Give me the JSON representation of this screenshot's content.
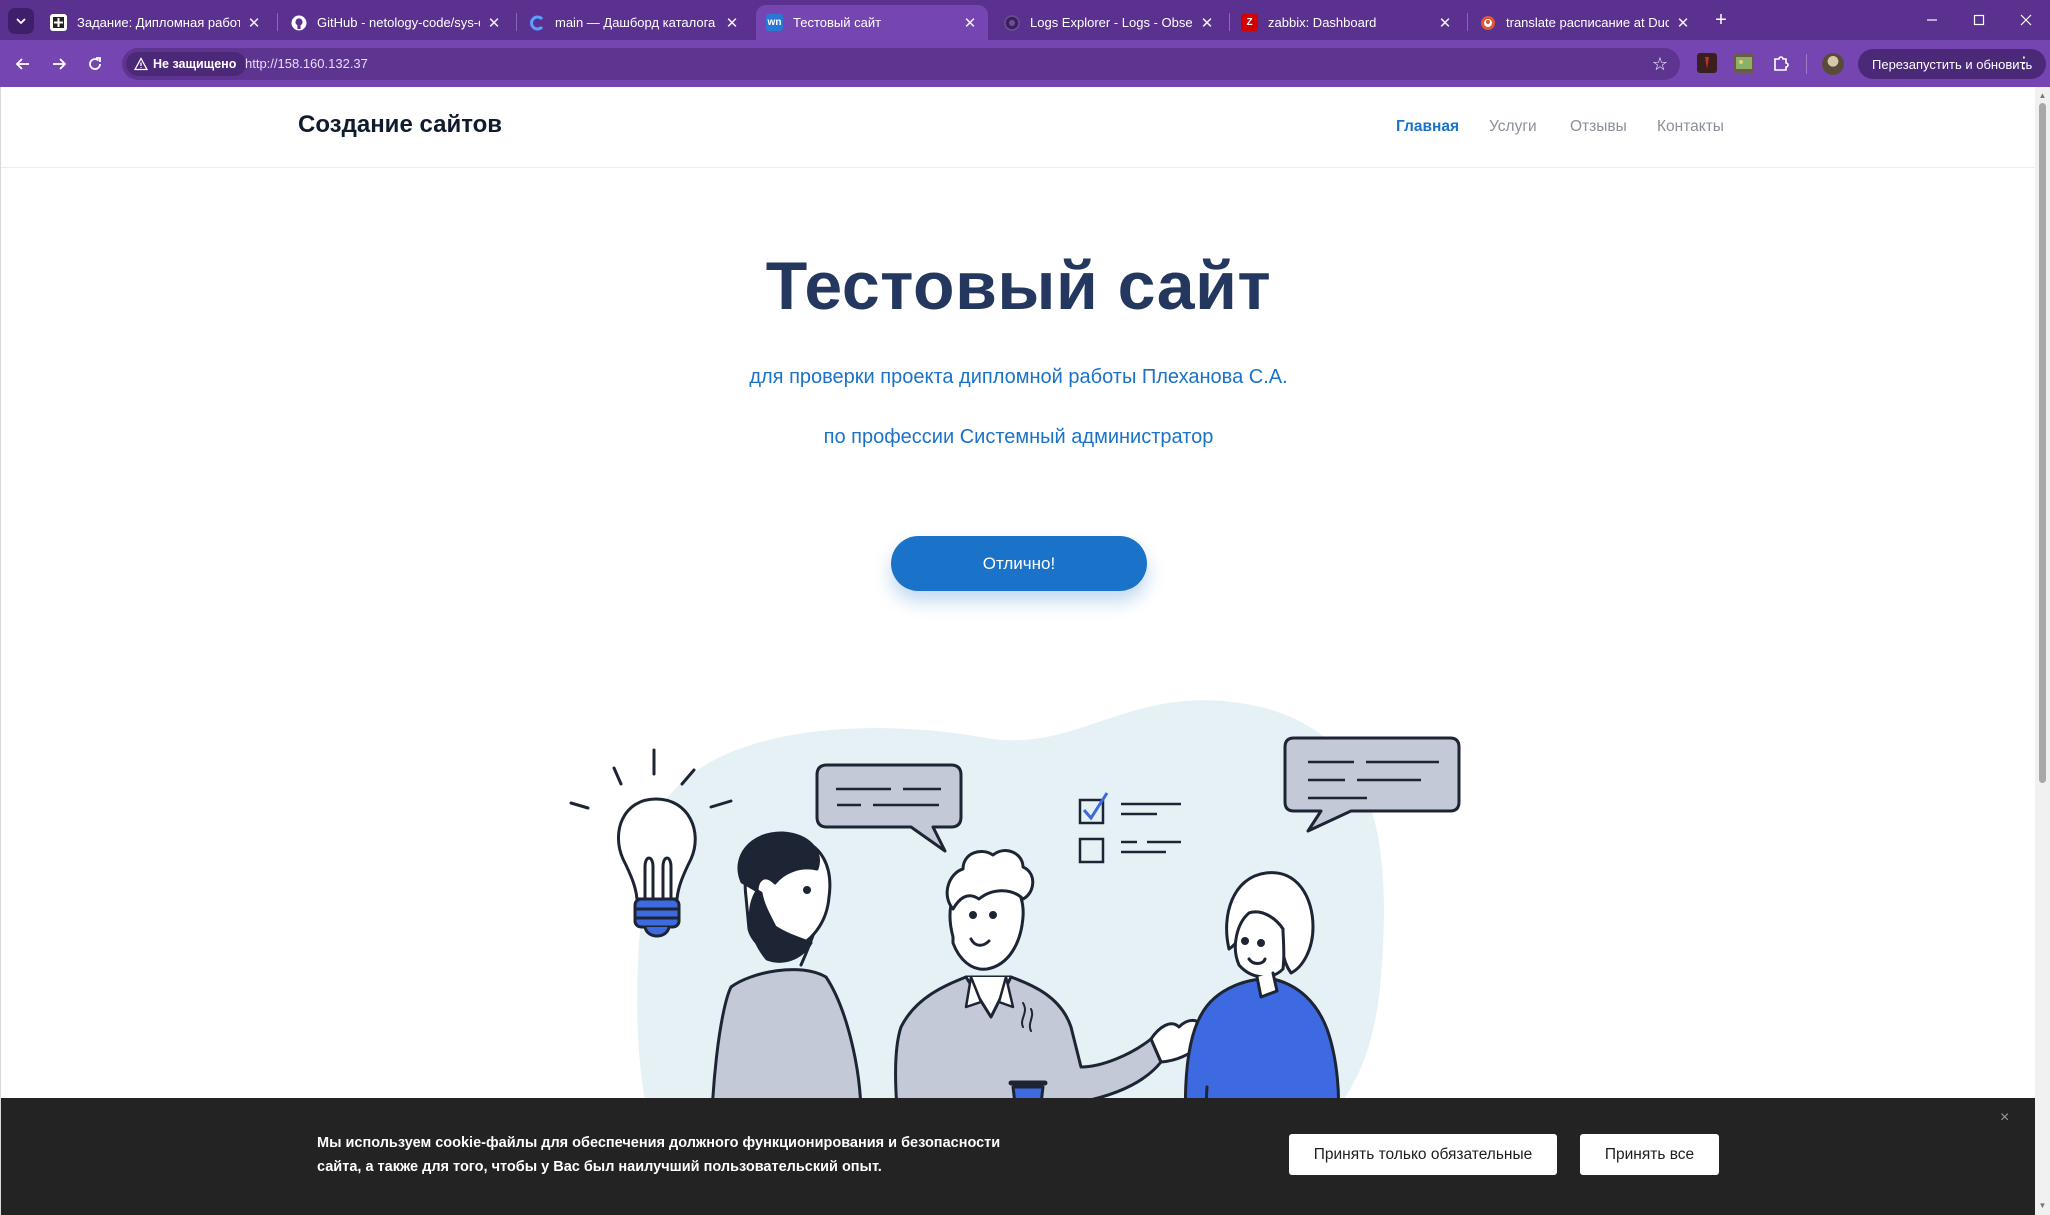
{
  "browser": {
    "tabs": [
      {
        "title": "Задание: Дипломная работа по...",
        "favicon": "netology-icon",
        "active": false
      },
      {
        "title": "GitHub - netology-code/sys-diplo...",
        "favicon": "github-icon",
        "active": false
      },
      {
        "title": "main — Дашборд каталога | Yan...",
        "favicon": "yandex-cloud-icon",
        "active": false
      },
      {
        "title": "Тестовый сайт",
        "favicon": "wn-icon",
        "favicon_text": "wn",
        "active": true
      },
      {
        "title": "Logs Explorer - Logs - Observab...",
        "favicon": "elastic-icon",
        "active": false
      },
      {
        "title": "zabbix: Dashboard",
        "favicon": "zabbix-icon",
        "favicon_text": "Z",
        "active": false
      },
      {
        "title": "translate расписание at DuckDu...",
        "favicon": "duckduckgo-icon",
        "active": false
      }
    ],
    "security_label": "Не защищено",
    "url": "http://158.160.132.37",
    "update_button": "Перезапустить и обновить",
    "accent": "#7546b2",
    "tabstrip_color": "#5b3190"
  },
  "site": {
    "brand": "Создание сайтов",
    "nav": [
      "Главная",
      "Услуги",
      "Отзывы",
      "Контакты"
    ],
    "active_nav": "Главная",
    "hero": {
      "title": "Тестовый сайт",
      "subtitle1": "для проверки проекта дипломной работы Плеханова С.А.",
      "subtitle2": "по профессии Системный администратор",
      "cta": "Отлично!"
    },
    "colors": {
      "primary": "#1a73c8",
      "title": "#24385f",
      "accent_blue": "#3e6ae1"
    }
  },
  "cookie": {
    "text": "Мы используем cookie-файлы для обеспечения должного функционирования и безопасности сайта, а также для того, чтобы у Вас был наилучший пользовательский опыт.",
    "btn_required": "Принять только обязательные",
    "btn_all": "Принять все",
    "close": "×"
  }
}
